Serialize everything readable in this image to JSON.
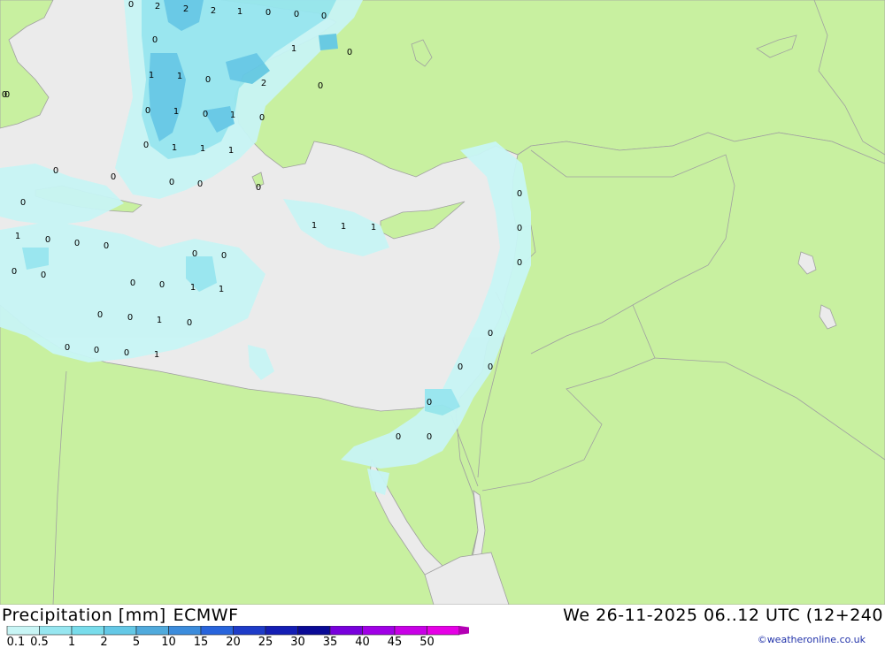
{
  "map": {
    "title": "Precipitation [mm]",
    "model": "ECMWF",
    "valid_time": "We 26-11-2025 06..12 UTC (12+240",
    "credit": "©weatheronline.co.uk",
    "colors": {
      "land": "#c8f0a0",
      "sea": "#ebebeb",
      "border": "#a0a0a0",
      "precip_light": "#c8f5f5",
      "precip_medium": "#96e6f0",
      "precip_heavy": "#64c8e6"
    },
    "point_values": [
      {
        "value": "0"
      },
      {
        "value": "2"
      },
      {
        "value": "2"
      },
      {
        "value": "2"
      },
      {
        "value": "1"
      },
      {
        "value": "0"
      },
      {
        "value": "0"
      },
      {
        "value": "0"
      },
      {
        "value": "0"
      },
      {
        "value": "1"
      },
      {
        "value": "0"
      },
      {
        "value": "1"
      },
      {
        "value": "1"
      },
      {
        "value": "0"
      },
      {
        "value": "2"
      },
      {
        "value": "0"
      },
      {
        "value": "0"
      },
      {
        "value": "0"
      },
      {
        "value": "1"
      },
      {
        "value": "0"
      },
      {
        "value": "1"
      },
      {
        "value": "0"
      },
      {
        "value": "0"
      },
      {
        "value": "1"
      },
      {
        "value": "1"
      },
      {
        "value": "1"
      },
      {
        "value": "0"
      },
      {
        "value": "0"
      },
      {
        "value": "0"
      },
      {
        "value": "0"
      },
      {
        "value": "0"
      },
      {
        "value": "0"
      },
      {
        "value": "1"
      },
      {
        "value": "0"
      },
      {
        "value": "0"
      },
      {
        "value": "0"
      },
      {
        "value": "0"
      },
      {
        "value": "0"
      },
      {
        "value": "0"
      },
      {
        "value": "0"
      },
      {
        "value": "0"
      },
      {
        "value": "0"
      },
      {
        "value": "0"
      },
      {
        "value": "1"
      },
      {
        "value": "1"
      },
      {
        "value": "1"
      },
      {
        "value": "1"
      },
      {
        "value": "0"
      },
      {
        "value": "0"
      },
      {
        "value": "1"
      },
      {
        "value": "0"
      },
      {
        "value": "0"
      },
      {
        "value": "1"
      },
      {
        "value": "0"
      },
      {
        "value": "0"
      },
      {
        "value": "0"
      },
      {
        "value": "0"
      },
      {
        "value": "0"
      },
      {
        "value": "0"
      },
      {
        "value": "0"
      },
      {
        "value": "1"
      },
      {
        "value": "0"
      },
      {
        "value": "0"
      },
      {
        "value": "0"
      },
      {
        "value": "0"
      }
    ]
  },
  "legend": {
    "labels": [
      "0.1",
      "0.5",
      "1",
      "2",
      "5",
      "10",
      "15",
      "20",
      "25",
      "30",
      "35",
      "40",
      "45",
      "50"
    ],
    "colors": [
      "#c8f5f5",
      "#96e6f0",
      "#78dceb",
      "#64c8e6",
      "#50aadc",
      "#3c8cdc",
      "#2864dc",
      "#1e3cc8",
      "#141eb4",
      "#0a0a96",
      "#7800dc",
      "#a000e6",
      "#c800e6",
      "#e600e6",
      "#b400b4"
    ]
  }
}
